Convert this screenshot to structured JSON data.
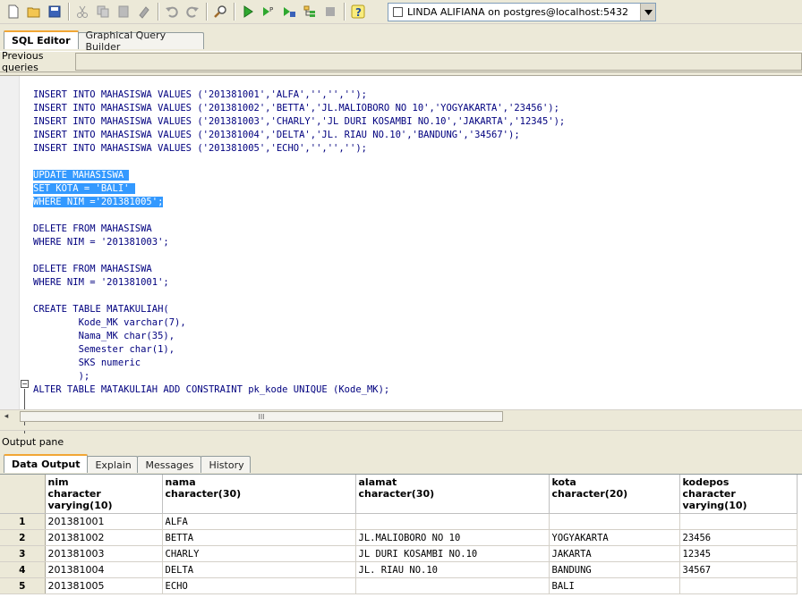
{
  "toolbar": {
    "icons": [
      "new-icon",
      "open-icon",
      "save-icon",
      "cut-icon",
      "copy-icon",
      "paste-icon",
      "clear-icon",
      "undo-icon",
      "redo-icon",
      "find-icon",
      "execute-icon",
      "execute-pgscript-icon",
      "execute-to-file-icon",
      "explain-icon",
      "cancel-icon",
      "help-icon"
    ],
    "connection": "LINDA ALIFIANA on postgres@localhost:5432"
  },
  "editor_tabs": [
    {
      "label": "SQL Editor",
      "active": true
    },
    {
      "label": "Graphical Query Builder",
      "active": false
    }
  ],
  "previous_queries_label": "Previous queries",
  "output_pane_label": "Output pane",
  "output_tabs": [
    {
      "label": "Data Output",
      "active": true
    },
    {
      "label": "Explain",
      "active": false
    },
    {
      "label": "Messages",
      "active": false
    },
    {
      "label": "History",
      "active": false
    }
  ],
  "code_lines": [
    "INSERT INTO MAHASISWA VALUES ('201381001','ALFA','','','');",
    "INSERT INTO MAHASISWA VALUES ('201381002','BETTA','JL.MALIOBORO NO 10','YOGYAKARTA','23456');",
    "INSERT INTO MAHASISWA VALUES ('201381003','CHARLY','JL DURI KOSAMBI NO.10','JAKARTA','12345');",
    "INSERT INTO MAHASISWA VALUES ('201381004','DELTA','JL. RIAU NO.10','BANDUNG','34567');",
    "INSERT INTO MAHASISWA VALUES ('201381005','ECHO','','','');",
    "",
    "UPDATE MAHASISWA ",
    "SET KOTA = 'BALI' ",
    "WHERE NIM ='201381005';",
    "",
    "DELETE FROM MAHASISWA",
    "WHERE NIM = '201381003';",
    "",
    "DELETE FROM MAHASISWA",
    "WHERE NIM = '201381001';",
    "",
    "CREATE TABLE MATAKULIAH(",
    "        Kode_MK varchar(7),",
    "        Nama_MK char(35),",
    "        Semester char(1),",
    "        SKS numeric",
    "        );",
    "ALTER TABLE MATAKULIAH ADD CONSTRAINT pk_kode UNIQUE (Kode_MK);"
  ],
  "selected_lines": [
    6,
    7,
    8
  ],
  "scroll_thumb_label": "III",
  "grid": {
    "columns": [
      {
        "name": "nim",
        "type": "character varying(10)"
      },
      {
        "name": "nama",
        "type": "character(30)"
      },
      {
        "name": "alamat",
        "type": "character(30)"
      },
      {
        "name": "kota",
        "type": "character(20)"
      },
      {
        "name": "kodepos",
        "type": "character varying(10)"
      }
    ],
    "rows": [
      {
        "n": "1",
        "cells": [
          "201381001",
          "ALFA",
          "",
          "",
          ""
        ]
      },
      {
        "n": "2",
        "cells": [
          "201381002",
          "BETTA",
          "JL.MALIOBORO NO 10",
          "YOGYAKARTA",
          "23456"
        ]
      },
      {
        "n": "3",
        "cells": [
          "201381003",
          "CHARLY",
          "JL DURI KOSAMBI NO.10",
          "JAKARTA",
          "12345"
        ]
      },
      {
        "n": "4",
        "cells": [
          "201381004",
          "DELTA",
          "JL. RIAU NO.10",
          "BANDUNG",
          "34567"
        ]
      },
      {
        "n": "5",
        "cells": [
          "201381005",
          "ECHO",
          "",
          "BALI",
          ""
        ]
      }
    ]
  }
}
